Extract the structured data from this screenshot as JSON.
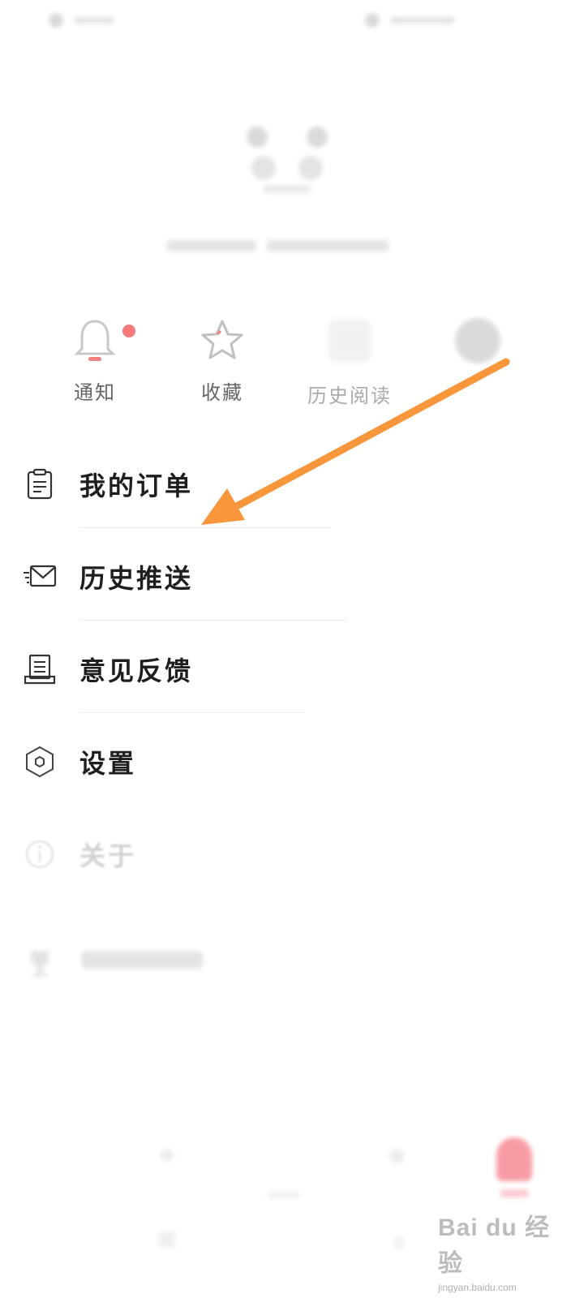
{
  "quick": [
    {
      "label": "通知",
      "icon": "bell-icon",
      "badge": true
    },
    {
      "label": "收藏",
      "icon": "star-icon",
      "badge": false
    },
    {
      "label": "历史阅读",
      "icon": "history-thumb-icon",
      "badge": false
    },
    {
      "label": "",
      "icon": "thumb-icon",
      "badge": false
    }
  ],
  "menu": [
    {
      "label": "我的订单",
      "icon": "clipboard-icon"
    },
    {
      "label": "历史推送",
      "icon": "mail-send-icon"
    },
    {
      "label": "意见反馈",
      "icon": "feedback-icon"
    },
    {
      "label": "设置",
      "icon": "hexagon-settings-icon"
    },
    {
      "label": "关于",
      "icon": "info-icon"
    },
    {
      "label": "",
      "icon": "trophy-icon"
    }
  ],
  "watermark": {
    "logo": "Bai du 经验",
    "url": "jingyan.baidu.com"
  },
  "colors": {
    "accent": "#f24d5b",
    "arrow": "#f7963a",
    "text": "#1e1e1e",
    "muted": "#666666"
  }
}
